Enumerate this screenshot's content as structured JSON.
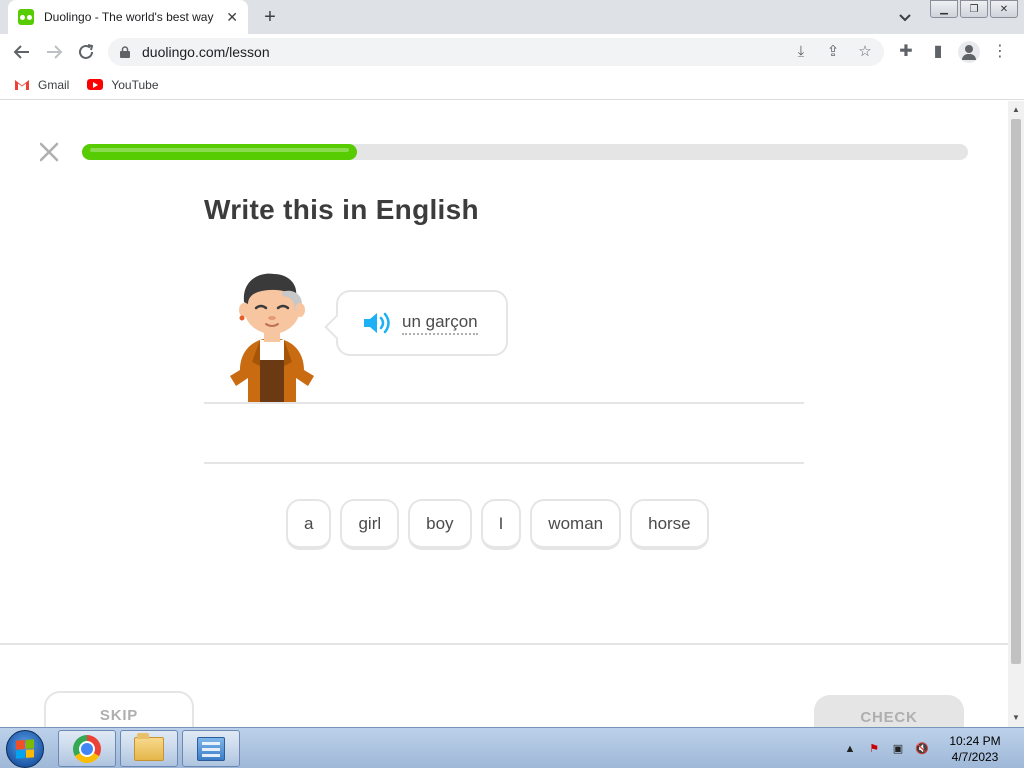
{
  "browser": {
    "tab_title": "Duolingo - The world's best way",
    "url": "duolingo.com/lesson",
    "bookmarks": [
      {
        "label": "Gmail"
      },
      {
        "label": "YouTube"
      }
    ]
  },
  "lesson": {
    "progress_percent": 31,
    "heading": "Write this in English",
    "prompt_text": "un garçon",
    "word_bank": [
      "a",
      "girl",
      "boy",
      "I",
      "woman",
      "horse"
    ],
    "skip_label": "SKIP",
    "check_label": "CHECK",
    "colors": {
      "progress_fill": "#58cc02",
      "speaker": "#1cb0f6",
      "heading": "#3c3c3c"
    }
  },
  "taskbar": {
    "time": "10:24 PM",
    "date": "4/7/2023",
    "apps": [
      "chrome-icon",
      "file-explorer-icon",
      "control-panel-icon"
    ]
  }
}
